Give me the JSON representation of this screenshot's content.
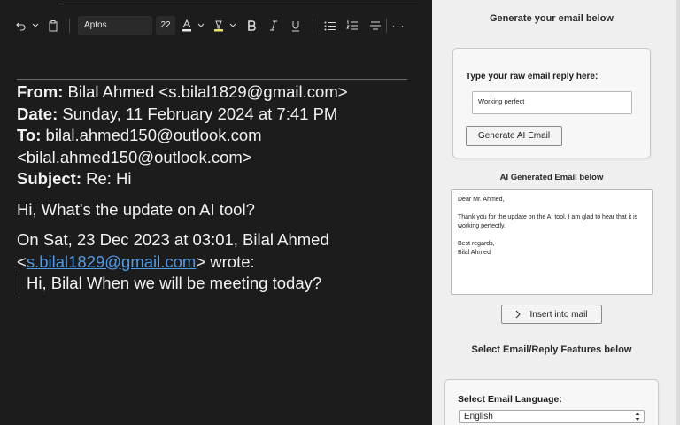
{
  "toolbar": {
    "font_name": "Aptos",
    "font_size": "22",
    "icons": [
      "undo-icon",
      "chevron-down-icon",
      "clipboard-icon",
      "font-color-icon",
      "highlight-icon",
      "bold-icon",
      "italic-icon",
      "underline-icon",
      "bullet-list-icon",
      "numbered-list-icon",
      "strikethrough-icon",
      "more-icon"
    ]
  },
  "email": {
    "from_label": "From:",
    "from_value": " Bilal Ahmed <s.bilal1829@gmail.com>",
    "date_label": "Date:",
    "date_value": " Sunday, 11 February 2024 at 7:41 PM",
    "to_label": "To:",
    "to_value": " bilal.ahmed150@outlook.com",
    "to_value_line2": "<bilal.ahmed150@outlook.com>",
    "subject_label": "Subject:",
    "subject_value": " Re: Hi",
    "body": "Hi, What's the update on AI tool?",
    "quote_intro_1": "On Sat, 23 Dec 2023 at 03:01, Bilal Ahmed",
    "quote_intro_pre": "<",
    "quote_intro_link": "s.bilal1829@gmail.com",
    "quote_intro_post": "> wrote:",
    "quoted_text": "Hi, Bilal When we will be meeting today?"
  },
  "panel": {
    "title": "Generate your email below",
    "raw_label": "Type your raw email reply here:",
    "raw_value": "Working perfect",
    "generate_button": "Generate AI Email",
    "ai_title": "AI Generated Email below",
    "ai_text": "Dear Mr. Ahmed,\n\nThank you for the update on the AI tool. I am glad to hear that it is working perfectly.\n\nBest regards,\nBilal Ahmed",
    "insert_button": "Insert into mail",
    "insert_icon": "chevron-right-icon",
    "features_title": "Select Email/Reply Features below",
    "language_label": "Select Email Language:",
    "language_value": "English"
  }
}
